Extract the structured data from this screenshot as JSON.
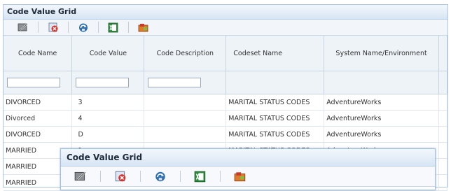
{
  "main": {
    "title": "Code Value Grid",
    "toolbar": [
      "edit-icon",
      "delete-icon",
      "refresh-icon",
      "export-excel-icon",
      "tools-icon"
    ],
    "columns": [
      "Code Name",
      "Code Value",
      "Code Description",
      "Codeset Name",
      "System Name/Environment"
    ],
    "rows": [
      {
        "name": "DIVORCED",
        "value": "3",
        "description": "",
        "codeset": "MARITAL STATUS CODES",
        "system": "AdventureWorks"
      },
      {
        "name": "Divorced",
        "value": "4",
        "description": "",
        "codeset": "MARITAL STATUS CODES",
        "system": "AdventureWorks"
      },
      {
        "name": "DIVORCED",
        "value": "D",
        "description": "",
        "codeset": "MARITAL STATUS CODES",
        "system": "AdventureWorks"
      },
      {
        "name": "MARRIED",
        "value": "1",
        "description": "",
        "codeset": "MARITAL STATUS CODES",
        "system": "AdventureWorks"
      },
      {
        "name": "MARRIED",
        "value": "",
        "description": "",
        "codeset": "",
        "system": ""
      },
      {
        "name": "MARRIED",
        "value": "",
        "description": "",
        "codeset": "",
        "system": ""
      }
    ]
  },
  "front": {
    "title": "Code Value Grid",
    "toolbar": [
      "edit-icon",
      "delete-icon",
      "refresh-icon",
      "export-excel-icon",
      "tools-icon"
    ]
  },
  "colors": {
    "header_bg": "#eef3f8",
    "title_bg": "#d8e5f4",
    "border": "#aec5e2"
  }
}
